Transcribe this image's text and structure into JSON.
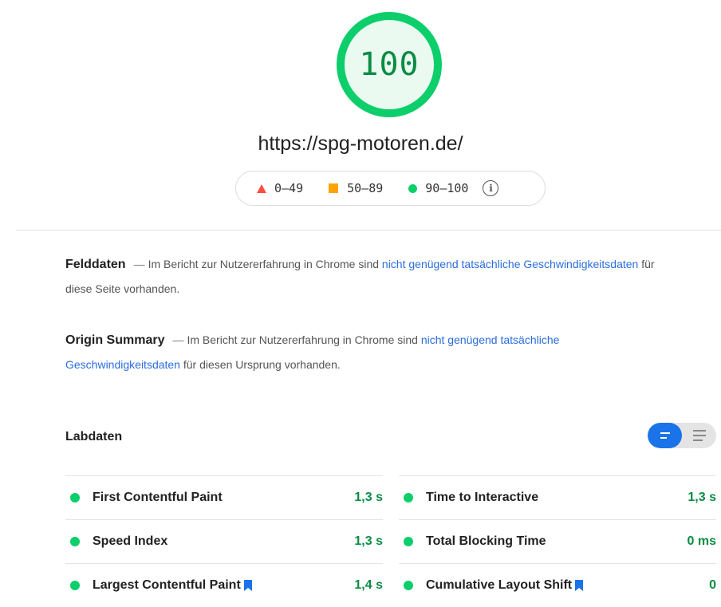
{
  "score": {
    "value": "100",
    "ring_color": "#0cce6b",
    "fill_color": "#eafaf1",
    "fraction": 1.0
  },
  "url": "https://spg-motoren.de/",
  "legend": {
    "items": [
      {
        "range": "0–49",
        "color": "#ff4e42",
        "icon": "triangle-icon"
      },
      {
        "range": "50–89",
        "color": "#ffa400",
        "icon": "square-icon"
      },
      {
        "range": "90–100",
        "color": "#0cce6b",
        "icon": "circle-icon"
      }
    ],
    "info_icon": "info-icon"
  },
  "field_data": {
    "title": "Felddaten",
    "dash": "—",
    "text_before": "Im Bericht zur Nutzererfahrung in Chrome sind ",
    "link": "nicht genügend tatsächliche Geschwindigkeitsdaten",
    "text_after": " für diese Seite vorhanden."
  },
  "origin_summary": {
    "title": "Origin Summary",
    "dash": "—",
    "text_before": "Im Bericht zur Nutzererfahrung in Chrome sind ",
    "link": "nicht genügend tatsächliche Geschwindigkeitsdaten",
    "text_after": " für diesen Ursprung vorhanden."
  },
  "lab_data": {
    "title": "Labdaten",
    "metrics": [
      {
        "name": "First Contentful Paint",
        "value": "1,3 s"
      },
      {
        "name": "Time to Interactive",
        "value": "1,3 s"
      },
      {
        "name": "Speed Index",
        "value": "1,3 s"
      },
      {
        "name": "Total Blocking Time",
        "value": "0 ms"
      },
      {
        "name": "Largest Contentful Paint",
        "value": "1,4 s"
      },
      {
        "name": "Cumulative Layout Shift",
        "value": "0"
      }
    ]
  },
  "colors": {
    "link": "#2b6de0",
    "good": "#0cce6b",
    "good_text": "#0a8c43",
    "toggle_active": "#1a73e8"
  }
}
